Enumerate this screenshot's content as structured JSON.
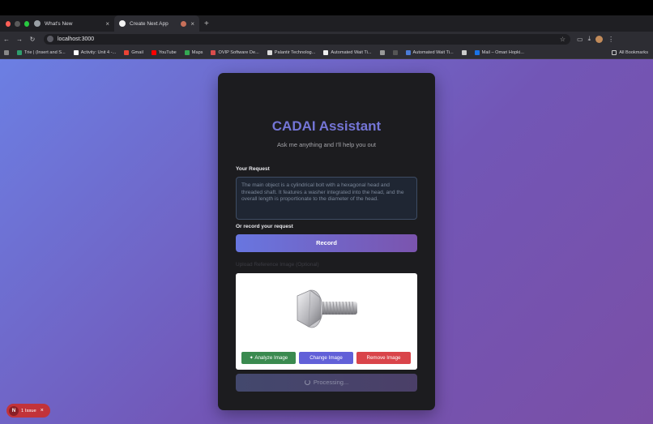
{
  "browser": {
    "tabs": [
      {
        "title": "What's New",
        "close": "×"
      },
      {
        "title": "Create Next App",
        "close": "×"
      }
    ],
    "new_tab": "+",
    "url": "localhost:3000",
    "bookmarks": [
      "Trie | (Insert and S...",
      "Activity: Unit 4 -...",
      "Gmail",
      "YouTube",
      "Maps",
      "OVIP Software De...",
      "Palantir Technolog...",
      "Automated Wait Ti...",
      "Automated Wait Ti...",
      "Mail – Omari Hopki..."
    ],
    "all_bookmarks": "All Bookmarks"
  },
  "app": {
    "title": "CADAI Assistant",
    "subtitle": "Ask me anything and I'll help you out",
    "request_label": "Your Request",
    "request_placeholder": "The main object is a cylindrical bolt with a hexagonal head and threaded shaft. It features a washer integrated into the head, and the overall length is proportionate to the diameter of the head.",
    "record_label": "Or record your request",
    "record_button": "Record",
    "upload_label": "Upload Reference Image (Optional)",
    "analyze_button": "Analyze Image",
    "change_button": "Change Image",
    "remove_button": "Remove Image",
    "processing": "Processing..."
  },
  "dev_overlay": {
    "badge": "N",
    "issues": "1 Issue",
    "close": "×"
  },
  "colors": {
    "accent": "#7475d6",
    "analyze": "#3a8a4f",
    "change": "#6160d8",
    "remove": "#d9444a"
  }
}
